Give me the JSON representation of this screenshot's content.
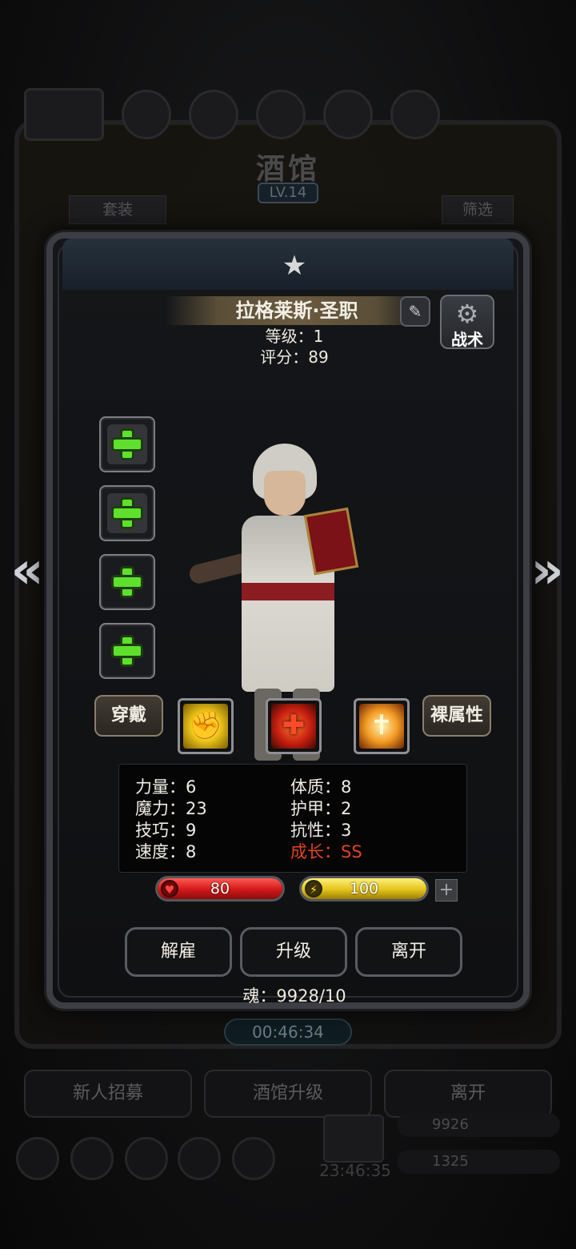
{
  "background": {
    "title": "酒馆",
    "level": "LV.14",
    "left_button": "套装",
    "right_button": "筛选",
    "timer": "00:46:34",
    "bottom_buttons": [
      "新人招募",
      "酒馆升级",
      "离开"
    ],
    "gift_timer": "23:46:35",
    "resource_gold": "9926",
    "resource_gem": "1325"
  },
  "hero": {
    "name": "拉格莱斯·圣职",
    "level_line": "等级：1",
    "score_line": "评分：89",
    "tactics_label": "战术"
  },
  "actions": {
    "wear": "穿戴",
    "naked_attr": "裸属性"
  },
  "skills": [
    {
      "icon": "fist-icon"
    },
    {
      "icon": "heal-cross-icon"
    },
    {
      "icon": "holy-light-icon"
    }
  ],
  "attributes": {
    "strength": "力量：6",
    "magic": "魔力：23",
    "skill": "技巧：9",
    "speed": "速度：8",
    "constitution": "体质：8",
    "armor": "护甲：2",
    "resistance": "抗性：3",
    "growth": "成长：SS"
  },
  "bars": {
    "hp": "80",
    "energy": "100",
    "hp_fill_percent": 100,
    "energy_fill_percent": 100
  },
  "buttons": {
    "dismiss": "解雇",
    "upgrade": "升级",
    "leave": "离开"
  },
  "soul": "魂：9928/10",
  "colors": {
    "growth_text": "#e0451e",
    "hp_bar": "#d01818",
    "energy_bar": "#e3c21a",
    "plus_green": "#5ee02c"
  }
}
